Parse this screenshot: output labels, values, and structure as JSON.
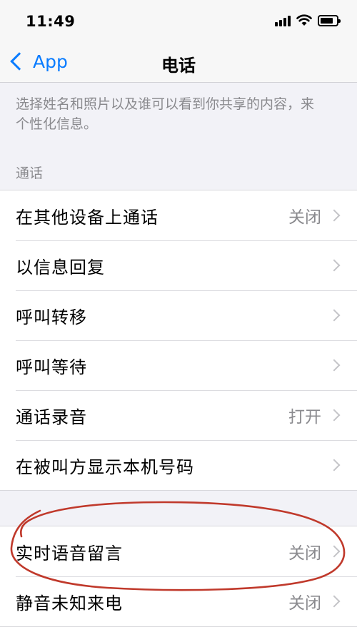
{
  "status_bar": {
    "time": "11:49"
  },
  "nav": {
    "back_label": "App",
    "title": "电话"
  },
  "description": "选择姓名和照片以及谁可以看到你共享的内容，来个性化信息。",
  "sections": {
    "calls": {
      "header": "通话",
      "rows": [
        {
          "label": "在其他设备上通话",
          "value": "关闭"
        },
        {
          "label": "以信息回复",
          "value": ""
        },
        {
          "label": "呼叫转移",
          "value": ""
        },
        {
          "label": "呼叫等待",
          "value": ""
        },
        {
          "label": "通话录音",
          "value": "打开"
        },
        {
          "label": "在被叫方显示本机号码",
          "value": ""
        }
      ]
    },
    "voice": {
      "rows": [
        {
          "label": "实时语音留言",
          "value": "关闭"
        },
        {
          "label": "静音未知来电",
          "value": "关闭"
        }
      ]
    }
  },
  "colors": {
    "accent": "#0a7cff",
    "annotation": "#c0392b"
  }
}
